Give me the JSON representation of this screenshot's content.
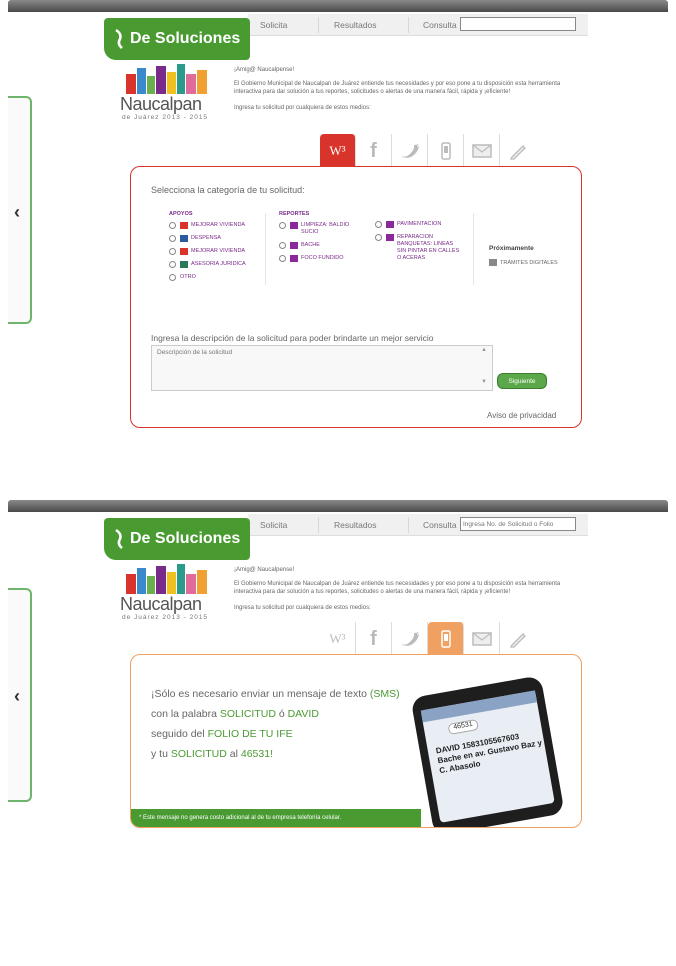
{
  "nav": {
    "items": [
      "Solicita",
      "Resultados",
      "Consulta"
    ],
    "search_placeholder_frame2": "Ingresa No. de Solicitud o Folio"
  },
  "brand": {
    "title": "De Soluciones"
  },
  "logo": {
    "word": "Naucalpan",
    "sub": "de Juárez 2013 - 2015"
  },
  "intro": {
    "greeting": "¡Amig@ Naucalpense!",
    "body": "El Gobierno Municipal de Naucalpan de Juárez entiende tus necesidades y por eso pone a tu disposición esta herramienta interactiva para dar solución a tus reportes, solicitudes o alertas de una manera fácil, rápida y ¡eficiente!",
    "channels": "Ingresa tu solicitud por cualquiera de estos medios:"
  },
  "channel_tabs": [
    {
      "name": "web-icon",
      "glyph": "W³"
    },
    {
      "name": "facebook-icon",
      "glyph": "f"
    },
    {
      "name": "twitter-icon",
      "glyph": "🐦"
    },
    {
      "name": "mobile-icon",
      "glyph": "▯"
    },
    {
      "name": "mail-icon",
      "glyph": "✉"
    },
    {
      "name": "pencil-icon",
      "glyph": "✎"
    }
  ],
  "form": {
    "title": "Selecciona la categoría de tu solicitud:",
    "apoyos": {
      "heading": "APOYOS",
      "options": [
        "MEJORAR VIVIENDA",
        "DESPENSA",
        "MEJORAR VIVIENDA",
        "ASESORIA JURIDICA",
        "OTRO"
      ]
    },
    "reportes": {
      "heading": "REPORTES",
      "options": [
        "LIMPIEZA: BALDIO SUCIO",
        "BACHE",
        "FOCO FUNDIDO"
      ]
    },
    "reportes2": {
      "options": [
        "PAVIMENTACION",
        "REPARACION BANQUETAS: LINEAS SIN PINTAR EN CALLES O ACERAS"
      ]
    },
    "proximamente": {
      "heading": "Próximamente",
      "item": "TRÁMITES DIGITALES"
    },
    "desc_label": "Ingresa la descripción de la solicitud para poder brindarte un mejor servicio",
    "desc_placeholder": "Descripción de la solicitud",
    "next": "Siguiente",
    "privacy": "Aviso de privacidad"
  },
  "sms": {
    "line1_a": "¡Sólo es necesario enviar un mensaje de texto ",
    "line1_b": "(SMS)",
    "line2_a": "con la palabra ",
    "line2_b": "SOLICITUD",
    "line2_c": " ó ",
    "line2_d": "DAVID",
    "line3_a": "seguido del ",
    "line3_b": "FOLIO DE TU IFE",
    "line4_a": "y tu ",
    "line4_b": "SOLICITUD",
    "line4_c": " al ",
    "line4_d": "46531!",
    "phone_number": "46531",
    "phone_message": "DAVID 1583105567603 Bache en av. Gustavo Baz y C. Abasolo",
    "footer": "* Este mensaje no genera costo adicional al de tu empresa telefonía celular."
  }
}
